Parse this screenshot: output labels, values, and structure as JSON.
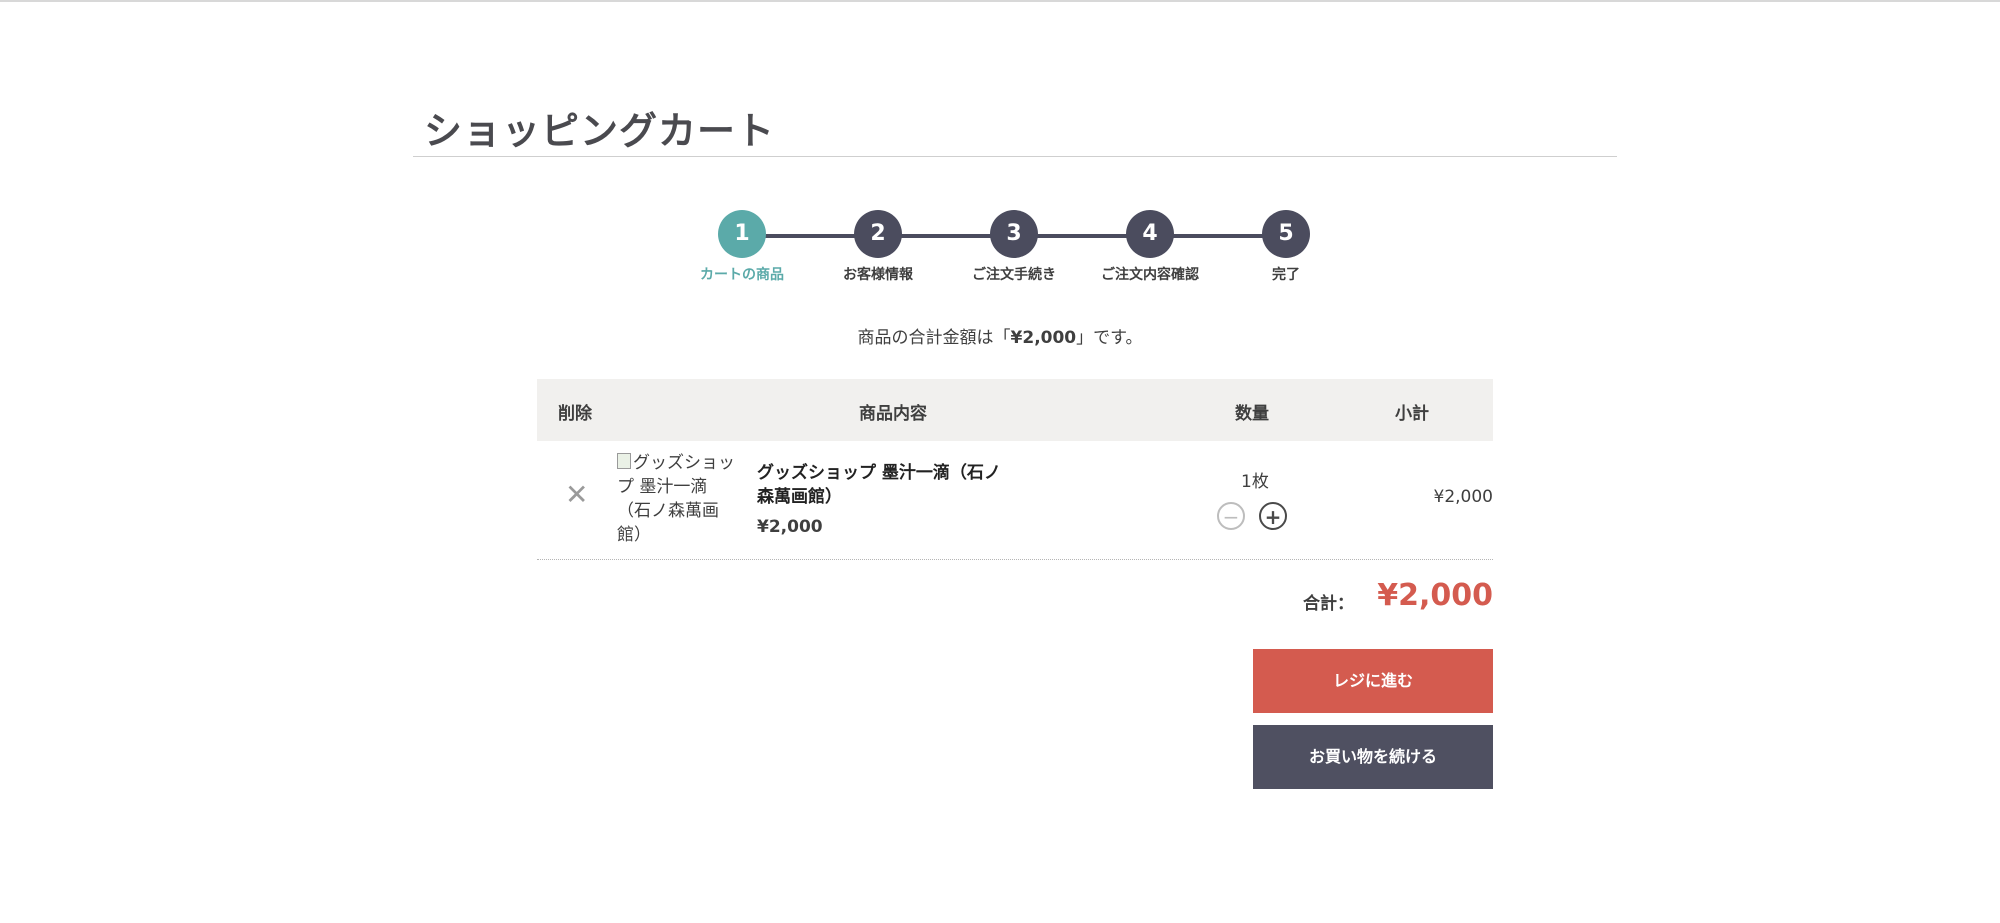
{
  "page": {
    "title": "ショッピングカート"
  },
  "steps": [
    {
      "number": "1",
      "label": "カートの商品",
      "active": true
    },
    {
      "number": "2",
      "label": "お客様情報",
      "active": false
    },
    {
      "number": "3",
      "label": "ご注文手続き",
      "active": false
    },
    {
      "number": "4",
      "label": "ご注文内容確認",
      "active": false
    },
    {
      "number": "5",
      "label": "完了",
      "active": false
    }
  ],
  "summary": {
    "prefix": "商品の合計金額は「",
    "amount": "¥2,000",
    "suffix": "」です。"
  },
  "table": {
    "headers": {
      "delete": "削除",
      "content": "商品内容",
      "quantity": "数量",
      "subtotal": "小計"
    },
    "rows": [
      {
        "remove_icon": "close-icon",
        "image_alt": "グッズショップ 墨汁一滴（石ノ森萬画館）",
        "name": "グッズショップ 墨汁一滴（石ノ森萬画館）",
        "price": "¥2,000",
        "quantity": "1枚",
        "subtotal": "¥2,000"
      }
    ]
  },
  "total": {
    "label": "合計：",
    "value": "¥2,000"
  },
  "buttons": {
    "checkout": "レジに進む",
    "continue": "お買い物を続ける"
  },
  "colors": {
    "accent_teal": "#5baaa9",
    "step_dark": "#4b4c5e",
    "price_red": "#d45b4f",
    "continue_dark": "#4f5061"
  }
}
